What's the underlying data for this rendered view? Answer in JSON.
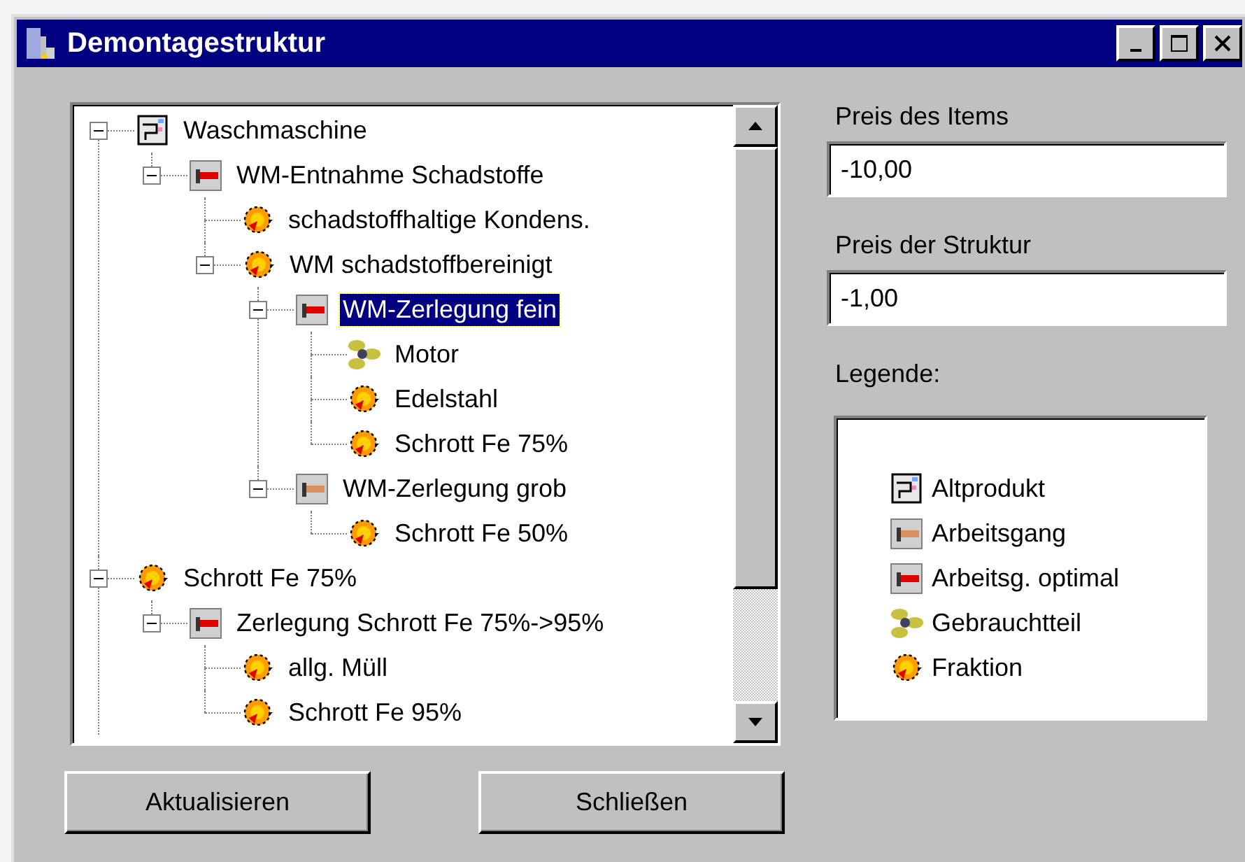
{
  "window": {
    "title": "Demontagestruktur"
  },
  "tree": [
    {
      "label": "Waschmaschine",
      "kind": "altprodukt",
      "selected": false,
      "expanded": true,
      "children": [
        {
          "label": "WM-Entnahme Schadstoffe",
          "kind": "arbeitsgang_optimal",
          "selected": false,
          "expanded": true,
          "children": [
            {
              "label": "schadstoffhaltige Kondens.",
              "kind": "fraktion",
              "selected": false
            },
            {
              "label": "WM schadstoffbereinigt",
              "kind": "fraktion",
              "selected": false,
              "expanded": true,
              "children": [
                {
                  "label": "WM-Zerlegung fein",
                  "kind": "arbeitsgang_optimal",
                  "selected": true,
                  "expanded": true,
                  "children": [
                    {
                      "label": "Motor",
                      "kind": "gebrauchtteil",
                      "selected": false
                    },
                    {
                      "label": "Edelstahl",
                      "kind": "fraktion",
                      "selected": false
                    },
                    {
                      "label": "Schrott Fe 75%",
                      "kind": "fraktion",
                      "selected": false
                    }
                  ]
                },
                {
                  "label": "WM-Zerlegung grob",
                  "kind": "arbeitsgang",
                  "selected": false,
                  "expanded": true,
                  "children": [
                    {
                      "label": "Schrott Fe 50%",
                      "kind": "fraktion",
                      "selected": false
                    }
                  ]
                }
              ]
            }
          ]
        }
      ]
    },
    {
      "label": "Schrott Fe 75%",
      "kind": "fraktion",
      "selected": false,
      "expanded": true,
      "children": [
        {
          "label": "Zerlegung Schrott Fe 75%->95%",
          "kind": "arbeitsgang_optimal",
          "selected": false,
          "expanded": true,
          "children": [
            {
              "label": "allg. Müll",
              "kind": "fraktion",
              "selected": false
            },
            {
              "label": "Schrott Fe 95%",
              "kind": "fraktion",
              "selected": false
            }
          ]
        }
      ]
    }
  ],
  "fields": [
    {
      "label": "Preis des Items",
      "value": "-10,00"
    },
    {
      "label": "Preis der Struktur",
      "value": "-1,00"
    }
  ],
  "legend": {
    "title": "Legende:",
    "items": [
      {
        "kind": "altprodukt",
        "label": "Altprodukt"
      },
      {
        "kind": "arbeitsgang",
        "label": "Arbeitsgang"
      },
      {
        "kind": "arbeitsgang_optimal",
        "label": "Arbeitsg. optimal"
      },
      {
        "kind": "gebrauchtteil",
        "label": "Gebrauchtteil"
      },
      {
        "kind": "fraktion",
        "label": "Fraktion"
      }
    ]
  },
  "buttons": [
    "Aktualisieren",
    "Schließen"
  ]
}
